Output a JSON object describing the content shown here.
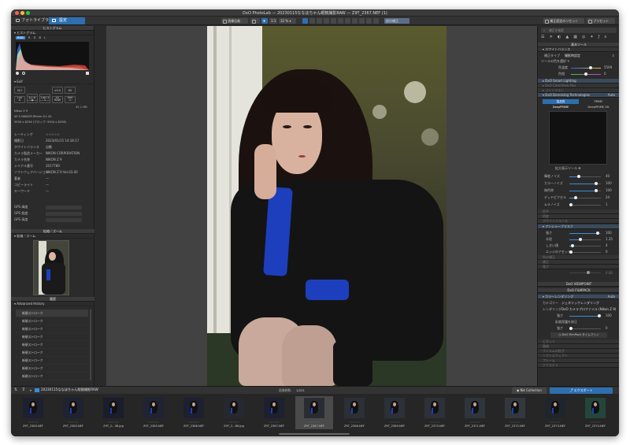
{
  "window": {
    "title": "DxO PhotoLab — 20230115ななほちゃん眼鏡撮影RAW — Z9T_2367.NEF (1)"
  },
  "toolbar": {
    "tab_library": "フォトライブラリ",
    "tab_customize": "設定",
    "compare_label": "画像比較",
    "zoom_fit": "1:1",
    "zoom_pct": "32 %",
    "picker_label": "部分補正",
    "apply_preset": "補正設定のリセット",
    "presets": "プリセット"
  },
  "left": {
    "histogram_title": "ヒストグラム",
    "hist_channels": [
      "RGB",
      "R",
      "G",
      "B",
      "L"
    ],
    "exif_title": "Exif",
    "exif_buttons": [
      "ISO 100",
      "ƒ/2.8",
      "1/60 s",
      "±0.0 EV",
      "85 mm"
    ],
    "file_size": "45.1 MB",
    "camera": "Nikon Z 9",
    "lens": "AF-S NIKKOR 85mm f/1.4G",
    "dimensions": "5504 x 8256 (クロップ: 5504 x 8256)",
    "meta_rows": [
      {
        "k": "レーティング",
        "v": "☆☆☆☆☆"
      },
      {
        "k": "撮影日",
        "v": "2023/01/15 14:18:17"
      },
      {
        "k": "ホワイトバランス",
        "v": "自動"
      },
      {
        "k": "カメラ製造メーカー",
        "v": "NIKON CORPORATION"
      },
      {
        "k": "カメラ名称",
        "v": "NIKON Z 9"
      },
      {
        "k": "シリアル番号",
        "v": "2017789"
      },
      {
        "k": "ソフトウェアバージョン",
        "v": "NIKON Z 9 Ver.03.00"
      },
      {
        "k": "著者",
        "v": "—"
      },
      {
        "k": "コピーライト",
        "v": "—"
      },
      {
        "k": "キーワード",
        "v": "—"
      }
    ],
    "gps_rows": [
      "GPS 緯度",
      "GPS 経度",
      "GPS 高度"
    ],
    "nav_title": "拡縮／ズーム",
    "nav_sub": "拡縮／ズーム",
    "history_title": "履歴",
    "history_sub": "Advanced History",
    "history_items": [
      "新規ストローク",
      "新規ストローク",
      "新規ストローク",
      "新規ストローク",
      "新規ストローク",
      "新規ストローク",
      "新規ストローク",
      "新規ストローク",
      "新規ストローク"
    ]
  },
  "right": {
    "search_placeholder": "補正を検索",
    "basic_tools": "基本ツール",
    "white_balance": "ホワイトバランス",
    "wb_type_label": "補正タイプ",
    "wb_type_value": "撮影時設定",
    "wb_picker": "ツールの色を選択",
    "temp_label": "色温度",
    "temp_value": "5569",
    "tint_label": "色相",
    "tint_value": "0",
    "smart_lighting": "DxO Smart Lighting",
    "clear_view": "DxO ClearView Plus",
    "contrast": "コントラスト",
    "denoise_title": "DxO Denoising Technologies",
    "denoise_value": "Auto",
    "mode_hq": "高品質",
    "mode_prime": "PRIME",
    "mode_deepprime": "DeepPRIME",
    "mode_deepprimexd": "DeepPRIME XD",
    "loupe_label": "拡大表示ツール",
    "noise_rows": [
      {
        "k": "輝度ノイズ",
        "v": "40"
      },
      {
        "k": "カラーノイズ",
        "v": "100"
      },
      {
        "k": "偽色除",
        "v": "100"
      },
      {
        "k": "デッドピクセル",
        "v": "24"
      },
      {
        "k": "ムラノイズ",
        "v": "1"
      }
    ],
    "dim_rows_1": [
      "色平",
      "明度",
      "ホワイトバランス"
    ],
    "unsharp_title": "アンシャープマスク",
    "unsharp_rows": [
      {
        "k": "強さ",
        "v": "100"
      },
      {
        "k": "半径",
        "v": "1.35"
      },
      {
        "k": "しきい値",
        "v": "4"
      },
      {
        "k": "エッジのアセット",
        "v": "0"
      }
    ],
    "dim_rows_2": [
      "色の補正",
      "補正",
      "強さ"
    ],
    "dim_value": "0.00",
    "viewpoint": "DxO VIEWPOINT",
    "filmpack": "DxO FILMPACK",
    "color_render": "カラーレンダリング",
    "color_render_value": "Auto",
    "category_label": "カテゴリー",
    "category_value": "ジェネリックレンダリング",
    "render_label": "レンダリング",
    "render_value": "DxO カメラプロファイル (Nikon Z 9)",
    "strength_label": "強さ",
    "strength_value": "100",
    "protect_label": "彩度保護を修正",
    "protect_strength_value": "0",
    "timemachine": "DxO FilmPack タイムマシン",
    "dim_rows_3": [
      "ビネット",
      "階調",
      "フィルムの粒子",
      "ソフトエフェクト",
      "フレーム",
      "テクスチャ"
    ]
  },
  "bottom": {
    "folder": "20230115ななほちゃん眼鏡撮影RAW",
    "count_label": "画像総数:",
    "count_value": "1/221",
    "nik": "Nik Collection",
    "export": "エクスポート"
  },
  "thumbs": [
    {
      "name": "Z9T_2365.NEF",
      "shade": "#1c2030"
    },
    {
      "name": "Z9T_2365.NEF",
      "shade": "#1e2232"
    },
    {
      "name": "Z9T_2...38.jpg",
      "shade": "#1a1d2b"
    },
    {
      "name": "Z9T_2365.NEF",
      "shade": "#1f2333"
    },
    {
      "name": "Z9T_2366.NEF",
      "shade": "#1c2030"
    },
    {
      "name": "Z9T_2...86.jpg",
      "shade": "#25282f"
    },
    {
      "name": "Z9T_2367.NEF",
      "shade": "#1c2030"
    },
    {
      "name": "Z9T_2367.NEF",
      "shade": "#2a2c33"
    },
    {
      "name": "Z9T_2368.NEF",
      "shade": "#2b2f36"
    },
    {
      "name": "Z9T_2369.NEF",
      "shade": "#2c3038"
    },
    {
      "name": "Z9T_2370.NEF",
      "shade": "#2d3139"
    },
    {
      "name": "Z9T_2371.NEF",
      "shade": "#30343c"
    },
    {
      "name": "Z9T_2372.NEF",
      "shade": "#33373e"
    },
    {
      "name": "Z9T_2373.NEF",
      "shade": "#20242c"
    },
    {
      "name": "Z9T_2374.NEF",
      "shade": "#24463a"
    }
  ]
}
